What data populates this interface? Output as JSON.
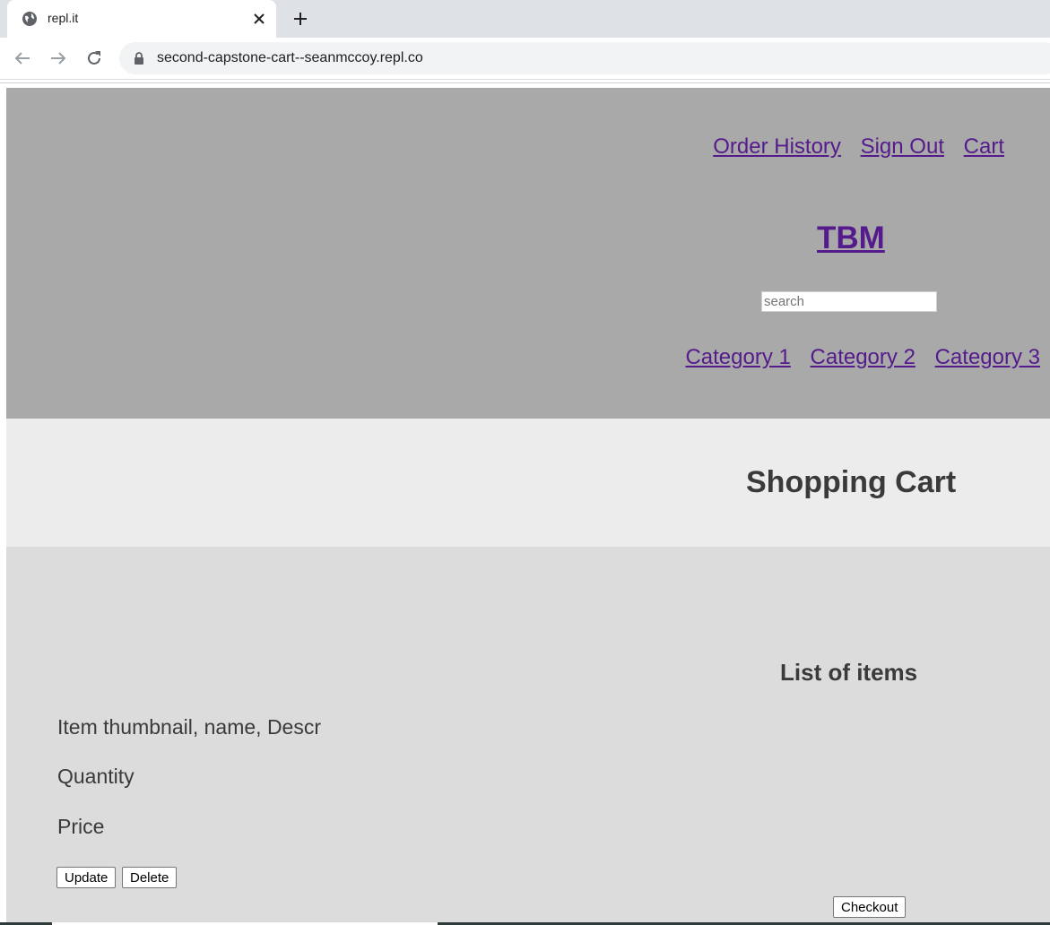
{
  "browser": {
    "tab_title": "repl.it",
    "url": "second-capstone-cart--seanmccoy.repl.co",
    "icons": {
      "favicon": "globe-icon",
      "close": "close-icon",
      "new_tab": "plus-icon",
      "back": "arrow-left-icon",
      "forward": "arrow-right-icon",
      "reload": "reload-icon",
      "lock": "lock-icon"
    }
  },
  "header": {
    "nav": {
      "order_history": "Order History",
      "sign_out": "Sign Out",
      "cart": "Cart"
    },
    "logo": "TBM",
    "search_placeholder": "search",
    "categories": [
      "Category 1",
      "Category 2",
      "Category 3"
    ]
  },
  "main": {
    "title": "Shopping Cart",
    "list_heading": "List of items",
    "item": {
      "description": "Item thumbnail, name, Descr",
      "quantity": "Quantity",
      "price": "Price"
    },
    "buttons": {
      "update": "Update",
      "delete": "Delete",
      "checkout": "Checkout"
    }
  },
  "colors": {
    "header_bg": "#a9a9a9",
    "title_band_bg": "#ececec",
    "cart_bg": "#dcdcdc",
    "link": "#551a8b",
    "text": "#3a3a3a"
  }
}
